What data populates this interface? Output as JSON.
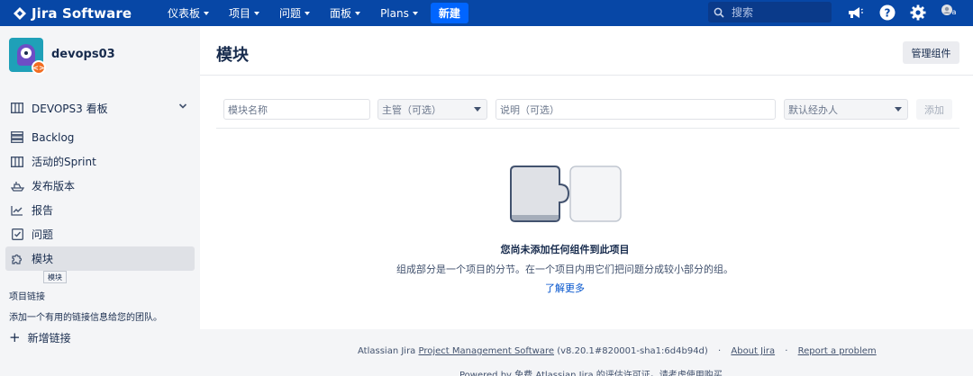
{
  "topnav": {
    "brand": "Jira Software",
    "items": [
      {
        "label": "仪表板"
      },
      {
        "label": "项目"
      },
      {
        "label": "问题"
      },
      {
        "label": "面板"
      },
      {
        "label": "Plans"
      }
    ],
    "create_label": "新建",
    "search_placeholder": "搜索",
    "icons": [
      "megaphone-icon",
      "help-icon",
      "settings-icon",
      "user-avatar"
    ],
    "colors": {
      "bar": "#0747a6",
      "create": "#0065ff"
    }
  },
  "sidebar": {
    "project_name": "devops03",
    "board_label": "DEVOPS3 看板",
    "items": [
      {
        "label": "Backlog",
        "icon": "backlog-icon"
      },
      {
        "label": "活动的Sprint",
        "icon": "board-icon"
      },
      {
        "label": "发布版本",
        "icon": "ship-icon"
      },
      {
        "label": "报告",
        "icon": "chart-icon"
      },
      {
        "label": "问题",
        "icon": "issues-icon"
      },
      {
        "label": "模块",
        "icon": "puzzle-icon",
        "active": true
      }
    ],
    "tooltip": "模块",
    "section_title": "项目链接",
    "section_desc": "添加一个有用的链接信息给您的团队。",
    "add_link_label": "新增链接"
  },
  "main": {
    "title": "模块",
    "manage_label": "管理组件",
    "form": {
      "name_placeholder": "模块名称",
      "lead_placeholder": "主管（可选）",
      "desc_placeholder": "说明（可选）",
      "assignee_placeholder": "默认经办人",
      "add_label": "添加"
    },
    "empty": {
      "title": "您尚未添加任何组件到此项目",
      "desc": "组成部分是一个项目的分节。在一个项目内用它们把问题分成较小部分的组。",
      "learn_more": "了解更多"
    }
  },
  "footer": {
    "prefix": "Atlassian Jira",
    "pms_link": "Project Management Software",
    "version": "(v8.20.1#820001-sha1:6d4b94d)",
    "about": "About Jira",
    "report": "Report a problem",
    "powered": "Powered by 免费 Atlassian Jira 的评估许可证。请考虑使用购买"
  }
}
